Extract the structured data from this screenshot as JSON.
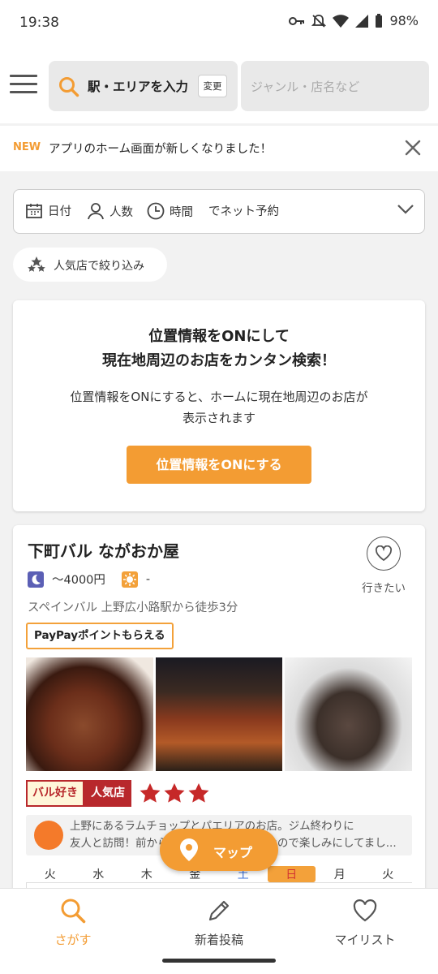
{
  "status": {
    "time": "19:38",
    "battery": "98%"
  },
  "header": {
    "area_label": "駅・エリアを入力",
    "change_label": "変更",
    "genre_placeholder": "ジャンル・店名など"
  },
  "notice": {
    "new_label": "NEW",
    "message": "アプリのホーム画面が新しくなりました！"
  },
  "reservation": {
    "date": "日付",
    "people": "人数",
    "time": "時間",
    "net": "でネット予約"
  },
  "filter": {
    "popular": "人気店で絞り込み"
  },
  "location_card": {
    "title_line1": "位置情報をONにして",
    "title_line2": "現在地周辺のお店をカンタン検索！",
    "desc_line1": "位置情報をONにすると、ホームに現在地周辺のお店が",
    "desc_line2": "表示されます",
    "button": "位置情報をONにする"
  },
  "shop": {
    "name": "下町バル ながおか屋",
    "dinner_budget": "～4000円",
    "lunch_budget": "-",
    "genre_access": "スペインバル 上野広小路駅から徒歩3分",
    "paypay": "PayPayポイントもらえる",
    "wish_label": "行きたい",
    "badge_tag": "バル好き",
    "badge_popular": "人気店",
    "stars": 3,
    "review_line1": "上野にあるラムチョップとパエリアのお店。ジム終わりに",
    "review_line2": "友人と訪問！前から気になっていたお店なので楽しみにしてまし..."
  },
  "calendar": {
    "days": [
      "火",
      "水",
      "木",
      "金",
      "土",
      "日",
      "月",
      "火"
    ]
  },
  "map_button": "マップ",
  "bottom_nav": {
    "search": "さがす",
    "posts": "新着投稿",
    "mylist": "マイリスト"
  },
  "colors": {
    "accent": "#f39c33",
    "badge_red": "#b8282c",
    "moon": "#5b5fb5"
  }
}
